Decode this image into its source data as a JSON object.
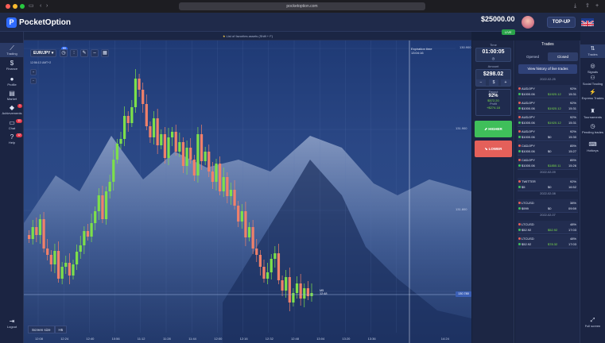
{
  "browser": {
    "url": "pocketoption.com"
  },
  "brand": {
    "name": "PocketOption",
    "logo_letter": "P"
  },
  "account": {
    "balance": "$25000.00",
    "type": "LIVE"
  },
  "topup_label": "TOP-UP",
  "favorites_hint": "List of favorites assets (Shift + F)",
  "left_nav": [
    {
      "label": "Trading",
      "icon": "chart-icon"
    },
    {
      "label": "Finance",
      "icon": "dollar-icon"
    },
    {
      "label": "Profile",
      "icon": "user-icon"
    },
    {
      "label": "Market",
      "icon": "cart-icon"
    },
    {
      "label": "Achievements",
      "icon": "diamond-icon",
      "badge": "1"
    },
    {
      "label": "Chat",
      "icon": "chat-icon",
      "badge": "11"
    },
    {
      "label": "Help",
      "icon": "help-icon",
      "badge": "12"
    },
    {
      "label": "Logout",
      "icon": "logout-icon"
    }
  ],
  "chart": {
    "pair": "EUR/JPY",
    "pair_badge": "80",
    "clock": "12:56:13 UMT+2",
    "expiration_label": "Expiration time",
    "expiration_value": "13:04:16",
    "ticks": [
      "12:08",
      "12:24",
      "12:40",
      "10:56",
      "11:12",
      "11:28",
      "11:44",
      "12:00",
      "12:16",
      "12:32",
      "12:48",
      "13:04",
      "13:20",
      "13:36",
      "14:24"
    ],
    "price_labels": [
      "130.900",
      "131.900",
      "131.800",
      "130.780"
    ],
    "current_marker": "M5",
    "current_time": "12:48",
    "screen_size_label": "Screen size",
    "screen_size_value": "H5"
  },
  "trade": {
    "time_label": "Time",
    "time_value": "01:00:05",
    "amount_label": "Amount",
    "amount_value": "$298.02",
    "payout_label": "Payout",
    "payout_pct": "92%",
    "payout_amount": "$572.20",
    "profit_label": "Profit",
    "profit_value": "+$274.18",
    "higher_label": "HIGHER",
    "lower_label": "LOWER"
  },
  "trades": {
    "title": "Trades",
    "tabs": [
      "Opened",
      "Closed"
    ],
    "history_button": "View history of live trades",
    "groups": [
      {
        "date": "2022-02-25",
        "rows": [
          {
            "pair": "AUD/JPY",
            "pct": "92%",
            "invest": "$1000.06",
            "payout": "$1920.12",
            "time": "15:31",
            "win": true
          },
          {
            "pair": "AUD/JPY",
            "pct": "92%",
            "invest": "$1000.06",
            "payout": "$1920.12",
            "time": "15:31",
            "win": true
          },
          {
            "pair": "AUD/JPY",
            "pct": "92%",
            "invest": "$1000.06",
            "payout": "$1920.12",
            "time": "15:31",
            "win": true
          },
          {
            "pair": "AUD/JPY",
            "pct": "92%",
            "invest": "$1000.06",
            "payout": "$0",
            "time": "15:30",
            "win": false
          },
          {
            "pair": "CAD/JPY",
            "pct": "85%",
            "invest": "$1000.06",
            "payout": "$0",
            "time": "15:27",
            "win": false
          },
          {
            "pair": "CAD/JPY",
            "pct": "85%",
            "invest": "$1000.06",
            "payout": "$1850.11",
            "time": "15:26",
            "win": true
          }
        ]
      },
      {
        "date": "2022-02-09",
        "rows": [
          {
            "pair": "TWITTER",
            "pct": "92%",
            "invest": "$5",
            "payout": "$0",
            "time": "16:52",
            "win": false
          }
        ]
      },
      {
        "date": "2022-02-08",
        "rows": [
          {
            "pair": "LTCUSD",
            "pct": "38%",
            "invest": "$999",
            "payout": "$0",
            "time": "09:59",
            "win": false
          }
        ]
      },
      {
        "date": "2022-02-07",
        "rows": [
          {
            "pair": "LTCUSD",
            "pct": "48%",
            "invest": "$52.92",
            "payout": "$52.92",
            "time": "17:03",
            "win": true
          },
          {
            "pair": "LTCUSD",
            "pct": "48%",
            "invest": "$52.92",
            "payout": "$78.32",
            "time": "17:03",
            "win": true
          }
        ]
      }
    ]
  },
  "right_nav": [
    {
      "label": "Trades",
      "icon": "trades-icon"
    },
    {
      "label": "Signals",
      "icon": "signals-icon"
    },
    {
      "label": "Social Trading",
      "icon": "social-icon"
    },
    {
      "label": "Express Trades",
      "icon": "express-icon"
    },
    {
      "label": "Tournaments",
      "icon": "trophy-icon"
    },
    {
      "label": "Pending trades",
      "icon": "pending-icon"
    },
    {
      "label": "Hotkeys",
      "icon": "keyboard-icon"
    },
    {
      "label": "Full screen",
      "icon": "fullscreen-icon"
    }
  ],
  "colors": {
    "bull": "#7de04a",
    "bear": "#f0806a",
    "accent": "#2f6bff",
    "higher": "#3fbf5a",
    "lower": "#e4605a",
    "bg": "#16203a"
  }
}
